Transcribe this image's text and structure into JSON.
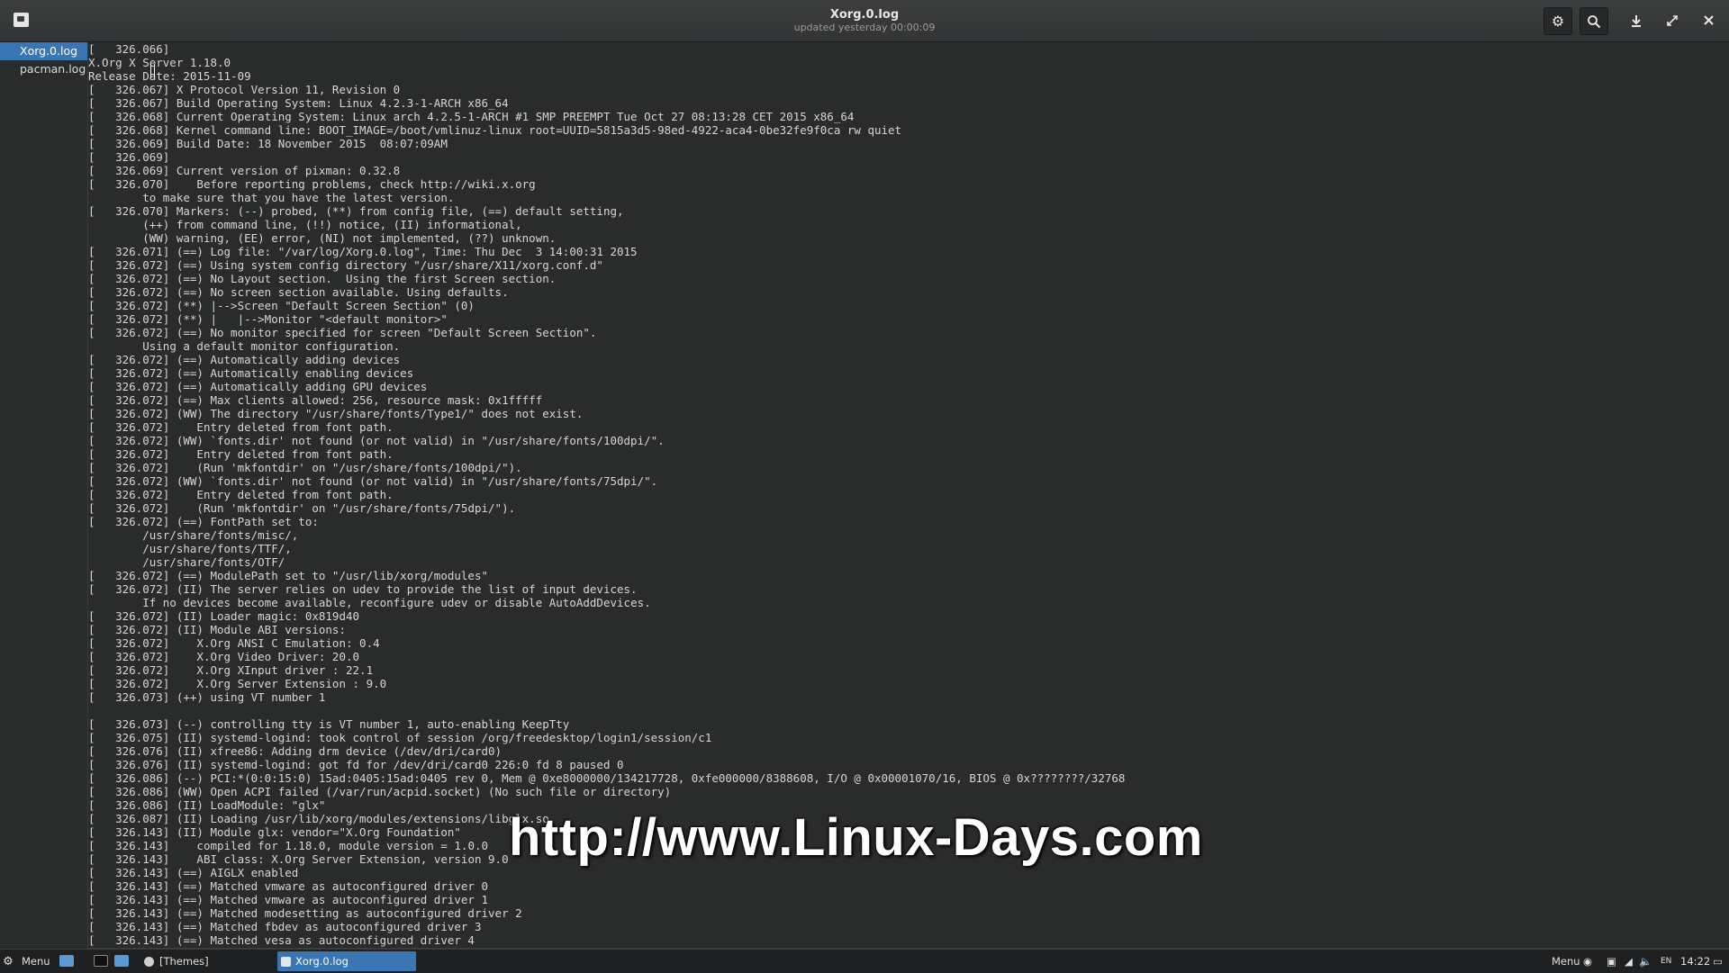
{
  "window": {
    "title": "Xorg.0.log",
    "subtitle": "updated yesterday 00:00:09"
  },
  "sidebar": {
    "items": [
      {
        "label": "Xorg.0.log",
        "active": true
      },
      {
        "label": "pacman.log",
        "active": false
      }
    ]
  },
  "log": {
    "lines": [
      "[   326.066] ",
      "X.Org X Server 1.18.0",
      "Release Date: 2015-11-09",
      "[   326.067] X Protocol Version 11, Revision 0",
      "[   326.067] Build Operating System: Linux 4.2.3-1-ARCH x86_64",
      "[   326.068] Current Operating System: Linux arch 4.2.5-1-ARCH #1 SMP PREEMPT Tue Oct 27 08:13:28 CET 2015 x86_64",
      "[   326.068] Kernel command line: BOOT_IMAGE=/boot/vmlinuz-linux root=UUID=5815a3d5-98ed-4922-aca4-0be32fe9f0ca rw quiet",
      "[   326.069] Build Date: 18 November 2015  08:07:09AM",
      "[   326.069] ",
      "[   326.069] Current version of pixman: 0.32.8",
      "[   326.070] \tBefore reporting problems, check http://wiki.x.org",
      "\tto make sure that you have the latest version.",
      "[   326.070] Markers: (--) probed, (**) from config file, (==) default setting,",
      "\t(++) from command line, (!!) notice, (II) informational,",
      "\t(WW) warning, (EE) error, (NI) not implemented, (??) unknown.",
      "[   326.071] (==) Log file: \"/var/log/Xorg.0.log\", Time: Thu Dec  3 14:00:31 2015",
      "[   326.072] (==) Using system config directory \"/usr/share/X11/xorg.conf.d\"",
      "[   326.072] (==) No Layout section.  Using the first Screen section.",
      "[   326.072] (==) No screen section available. Using defaults.",
      "[   326.072] (**) |-->Screen \"Default Screen Section\" (0)",
      "[   326.072] (**) |   |-->Monitor \"<default monitor>\"",
      "[   326.072] (==) No monitor specified for screen \"Default Screen Section\".",
      "\tUsing a default monitor configuration.",
      "[   326.072] (==) Automatically adding devices",
      "[   326.072] (==) Automatically enabling devices",
      "[   326.072] (==) Automatically adding GPU devices",
      "[   326.072] (==) Max clients allowed: 256, resource mask: 0x1fffff",
      "[   326.072] (WW) The directory \"/usr/share/fonts/Type1/\" does not exist.",
      "[   326.072] \tEntry deleted from font path.",
      "[   326.072] (WW) `fonts.dir' not found (or not valid) in \"/usr/share/fonts/100dpi/\".",
      "[   326.072] \tEntry deleted from font path.",
      "[   326.072] \t(Run 'mkfontdir' on \"/usr/share/fonts/100dpi/\").",
      "[   326.072] (WW) `fonts.dir' not found (or not valid) in \"/usr/share/fonts/75dpi/\".",
      "[   326.072] \tEntry deleted from font path.",
      "[   326.072] \t(Run 'mkfontdir' on \"/usr/share/fonts/75dpi/\").",
      "[   326.072] (==) FontPath set to:",
      "\t/usr/share/fonts/misc/,",
      "\t/usr/share/fonts/TTF/,",
      "\t/usr/share/fonts/OTF/",
      "[   326.072] (==) ModulePath set to \"/usr/lib/xorg/modules\"",
      "[   326.072] (II) The server relies on udev to provide the list of input devices.",
      "\tIf no devices become available, reconfigure udev or disable AutoAddDevices.",
      "[   326.072] (II) Loader magic: 0x819d40",
      "[   326.072] (II) Module ABI versions:",
      "[   326.072] \tX.Org ANSI C Emulation: 0.4",
      "[   326.072] \tX.Org Video Driver: 20.0",
      "[   326.072] \tX.Org XInput driver : 22.1",
      "[   326.072] \tX.Org Server Extension : 9.0",
      "[   326.073] (++) using VT number 1",
      "",
      "[   326.073] (--) controlling tty is VT number 1, auto-enabling KeepTty",
      "[   326.075] (II) systemd-logind: took control of session /org/freedesktop/login1/session/c1",
      "[   326.076] (II) xfree86: Adding drm device (/dev/dri/card0)",
      "[   326.076] (II) systemd-logind: got fd for /dev/dri/card0 226:0 fd 8 paused 0",
      "[   326.086] (--) PCI:*(0:0:15:0) 15ad:0405:15ad:0405 rev 0, Mem @ 0xe8000000/134217728, 0xfe000000/8388608, I/O @ 0x00001070/16, BIOS @ 0x????????/32768",
      "[   326.086] (WW) Open ACPI failed (/var/run/acpid.socket) (No such file or directory)",
      "[   326.086] (II) LoadModule: \"glx\"",
      "[   326.087] (II) Loading /usr/lib/xorg/modules/extensions/libglx.so",
      "[   326.143] (II) Module glx: vendor=\"X.Org Foundation\"",
      "[   326.143] \tcompiled for 1.18.0, module version = 1.0.0",
      "[   326.143] \tABI class: X.Org Server Extension, version 9.0",
      "[   326.143] (==) AIGLX enabled",
      "[   326.143] (==) Matched vmware as autoconfigured driver 0",
      "[   326.143] (==) Matched vmware as autoconfigured driver 1",
      "[   326.143] (==) Matched modesetting as autoconfigured driver 2",
      "[   326.143] (==) Matched fbdev as autoconfigured driver 3",
      "[   326.143] (==) Matched vesa as autoconfigured driver 4"
    ]
  },
  "watermark": "http://www.Linux-Days.com",
  "taskbar": {
    "menu_label": "Menu",
    "themes_label": "[Themes]",
    "active_task": "Xorg.0.log",
    "right_menu_label": "Menu",
    "lang": "EN",
    "clock": "14:22"
  }
}
